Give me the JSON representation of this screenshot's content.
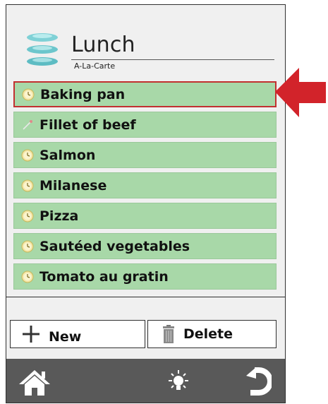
{
  "header": {
    "title": "Lunch",
    "subtitle": "A-La-Carte",
    "icon": "stacked-plates-icon"
  },
  "menu": {
    "items": [
      {
        "label": "Baking pan",
        "icon": "clock-icon",
        "selected": true
      },
      {
        "label": "Fillet of beef",
        "icon": "thermometer-probe-icon",
        "selected": false
      },
      {
        "label": "Salmon",
        "icon": "clock-icon",
        "selected": false
      },
      {
        "label": "Milanese",
        "icon": "clock-icon",
        "selected": false
      },
      {
        "label": "Pizza",
        "icon": "clock-icon",
        "selected": false
      },
      {
        "label": "Sautéed vegetables",
        "icon": "clock-icon",
        "selected": false
      },
      {
        "label": "Tomato au gratin",
        "icon": "clock-icon",
        "selected": false
      }
    ]
  },
  "actions": {
    "new_label": "New",
    "delete_label": "Delete"
  },
  "bottom_bar": {
    "icons": [
      "home-icon",
      "light-bulb-icon",
      "back-arrow-icon"
    ]
  },
  "colors": {
    "item_background": "#a8d8a8",
    "selected_border": "#c23030",
    "bottom_bar": "#595959",
    "pointer_arrow": "#d2232a"
  }
}
